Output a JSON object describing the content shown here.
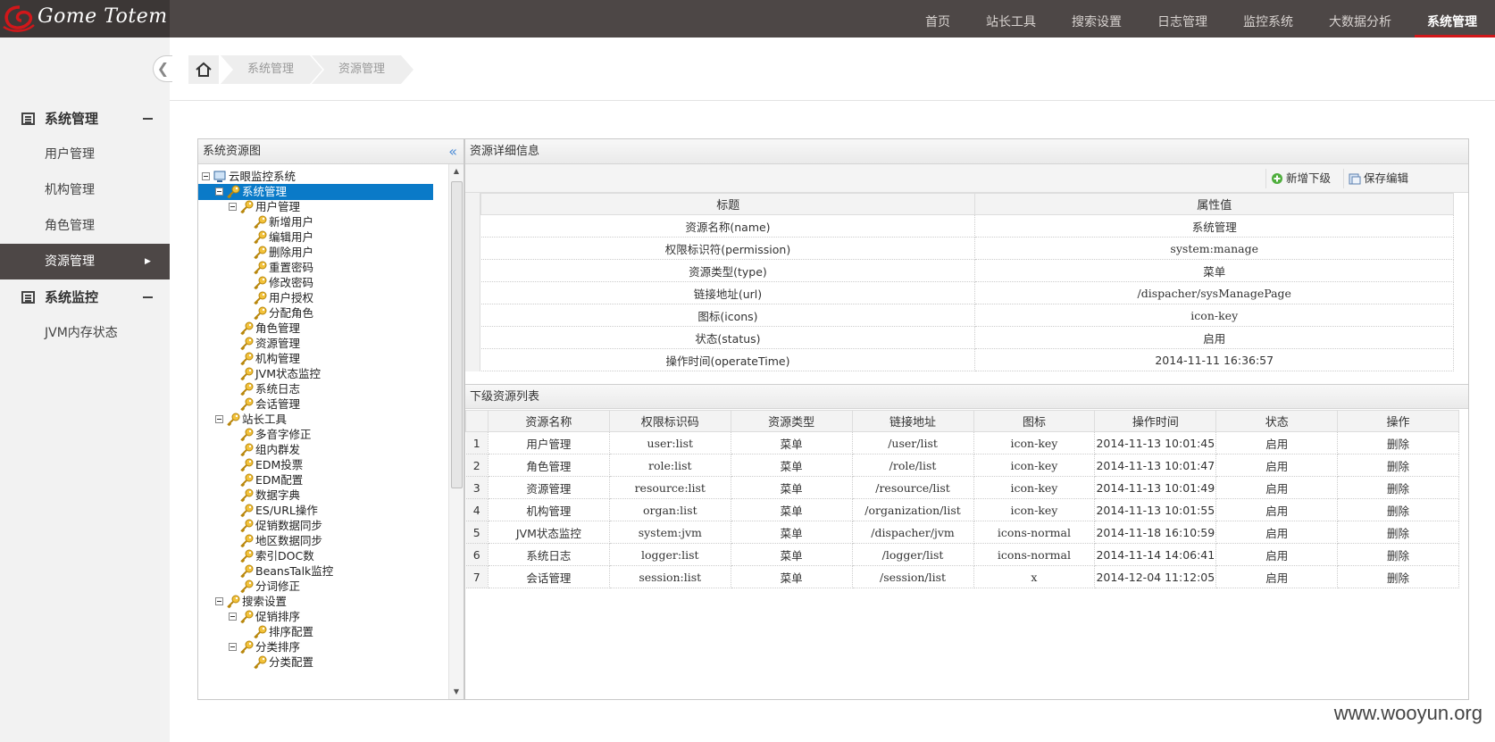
{
  "app": {
    "logo_text": "Gome Totem"
  },
  "topnav": [
    {
      "label": "首页",
      "active": false
    },
    {
      "label": "站长工具",
      "active": false
    },
    {
      "label": "搜索设置",
      "active": false
    },
    {
      "label": "日志管理",
      "active": false
    },
    {
      "label": "监控系统",
      "active": false
    },
    {
      "label": "大数据分析",
      "active": false
    },
    {
      "label": "系统管理",
      "active": true
    }
  ],
  "sidebar": {
    "groups": [
      {
        "label": "系统管理",
        "items": [
          "用户管理",
          "机构管理",
          "角色管理",
          "资源管理"
        ]
      },
      {
        "label": "系统监控",
        "items": [
          "JVM内存状态"
        ]
      }
    ],
    "active_item": "资源管理"
  },
  "breadcrumb": [
    "系统管理",
    "资源管理"
  ],
  "tree_panel": {
    "title": "系统资源图",
    "nodes": [
      {
        "label": "云眼监控系统",
        "depth": 0,
        "toggle": true,
        "icon": "computer-icon"
      },
      {
        "label": "系统管理",
        "depth": 1,
        "toggle": true,
        "icon": "key-icon",
        "selected": true
      },
      {
        "label": "用户管理",
        "depth": 2,
        "toggle": true,
        "icon": "key-icon"
      },
      {
        "label": "新增用户",
        "depth": 3,
        "icon": "key-icon"
      },
      {
        "label": "编辑用户",
        "depth": 3,
        "icon": "key-icon"
      },
      {
        "label": "删除用户",
        "depth": 3,
        "icon": "key-icon"
      },
      {
        "label": "重置密码",
        "depth": 3,
        "icon": "key-icon"
      },
      {
        "label": "修改密码",
        "depth": 3,
        "icon": "key-icon"
      },
      {
        "label": "用户授权",
        "depth": 3,
        "icon": "key-icon"
      },
      {
        "label": "分配角色",
        "depth": 3,
        "icon": "key-icon"
      },
      {
        "label": "角色管理",
        "depth": 2,
        "icon": "key-icon"
      },
      {
        "label": "资源管理",
        "depth": 2,
        "icon": "key-icon"
      },
      {
        "label": "机构管理",
        "depth": 2,
        "icon": "key-icon"
      },
      {
        "label": "JVM状态监控",
        "depth": 2,
        "icon": "key-icon"
      },
      {
        "label": "系统日志",
        "depth": 2,
        "icon": "key-icon"
      },
      {
        "label": "会话管理",
        "depth": 2,
        "icon": "key-icon"
      },
      {
        "label": "站长工具",
        "depth": 1,
        "toggle": true,
        "icon": "key-icon"
      },
      {
        "label": "多音字修正",
        "depth": 2,
        "icon": "key-icon"
      },
      {
        "label": "组内群发",
        "depth": 2,
        "icon": "key-icon"
      },
      {
        "label": "EDM投票",
        "depth": 2,
        "icon": "key-icon"
      },
      {
        "label": "EDM配置",
        "depth": 2,
        "icon": "key-icon"
      },
      {
        "label": "数据字典",
        "depth": 2,
        "icon": "key-icon"
      },
      {
        "label": "ES/URL操作",
        "depth": 2,
        "icon": "key-icon"
      },
      {
        "label": "促销数据同步",
        "depth": 2,
        "icon": "key-icon"
      },
      {
        "label": "地区数据同步",
        "depth": 2,
        "icon": "key-icon"
      },
      {
        "label": "索引DOC数",
        "depth": 2,
        "icon": "key-icon"
      },
      {
        "label": "BeansTalk监控",
        "depth": 2,
        "icon": "key-icon"
      },
      {
        "label": "分词修正",
        "depth": 2,
        "icon": "key-icon"
      },
      {
        "label": "搜索设置",
        "depth": 1,
        "toggle": true,
        "icon": "key-icon"
      },
      {
        "label": "促销排序",
        "depth": 2,
        "toggle": true,
        "icon": "key-icon"
      },
      {
        "label": "排序配置",
        "depth": 3,
        "icon": "key-icon"
      },
      {
        "label": "分类排序",
        "depth": 2,
        "toggle": true,
        "icon": "key-icon"
      },
      {
        "label": "分类配置",
        "depth": 3,
        "icon": "key-icon"
      }
    ]
  },
  "detail_panel": {
    "title": "资源详细信息",
    "toolbar": {
      "add_child_label": "新增下级",
      "save_edit_label": "保存编辑"
    },
    "headers": [
      "标题",
      "属性值"
    ],
    "rows": [
      [
        "资源名称(name)",
        "系统管理"
      ],
      [
        "权限标识符(permission)",
        "system:manage"
      ],
      [
        "资源类型(type)",
        "菜单"
      ],
      [
        "链接地址(url)",
        "/dispacher/sysManagePage"
      ],
      [
        "图标(icons)",
        "icon-key"
      ],
      [
        "状态(status)",
        "启用"
      ],
      [
        "操作时间(operateTime)",
        "2014-11-11 16:36:57"
      ]
    ]
  },
  "sub_list": {
    "title": "下级资源列表",
    "headers": [
      "资源名称",
      "权限标识码",
      "资源类型",
      "链接地址",
      "图标",
      "操作时间",
      "状态",
      "操作"
    ],
    "rows": [
      [
        "1",
        "用户管理",
        "user:list",
        "菜单",
        "/user/list",
        "icon-key",
        "2014-11-13 10:01:45",
        "启用",
        "删除"
      ],
      [
        "2",
        "角色管理",
        "role:list",
        "菜单",
        "/role/list",
        "icon-key",
        "2014-11-13 10:01:47",
        "启用",
        "删除"
      ],
      [
        "3",
        "资源管理",
        "resource:list",
        "菜单",
        "/resource/list",
        "icon-key",
        "2014-11-13 10:01:49",
        "启用",
        "删除"
      ],
      [
        "4",
        "机构管理",
        "organ:list",
        "菜单",
        "/organization/list",
        "icon-key",
        "2014-11-13 10:01:55",
        "启用",
        "删除"
      ],
      [
        "5",
        "JVM状态监控",
        "system:jvm",
        "菜单",
        "/dispacher/jvm",
        "icons-normal",
        "2014-11-18 16:10:59",
        "启用",
        "删除"
      ],
      [
        "6",
        "系统日志",
        "logger:list",
        "菜单",
        "/logger/list",
        "icons-normal",
        "2014-11-14 14:06:41",
        "启用",
        "删除"
      ],
      [
        "7",
        "会话管理",
        "session:list",
        "菜单",
        "/session/list",
        "x",
        "2014-12-04 11:12:05",
        "启用",
        "删除"
      ]
    ]
  },
  "watermark": "www.wooyun.org",
  "colors": {
    "topbar": "#4d4746",
    "accent": "#d1171a",
    "selection": "#0a7ac8"
  }
}
